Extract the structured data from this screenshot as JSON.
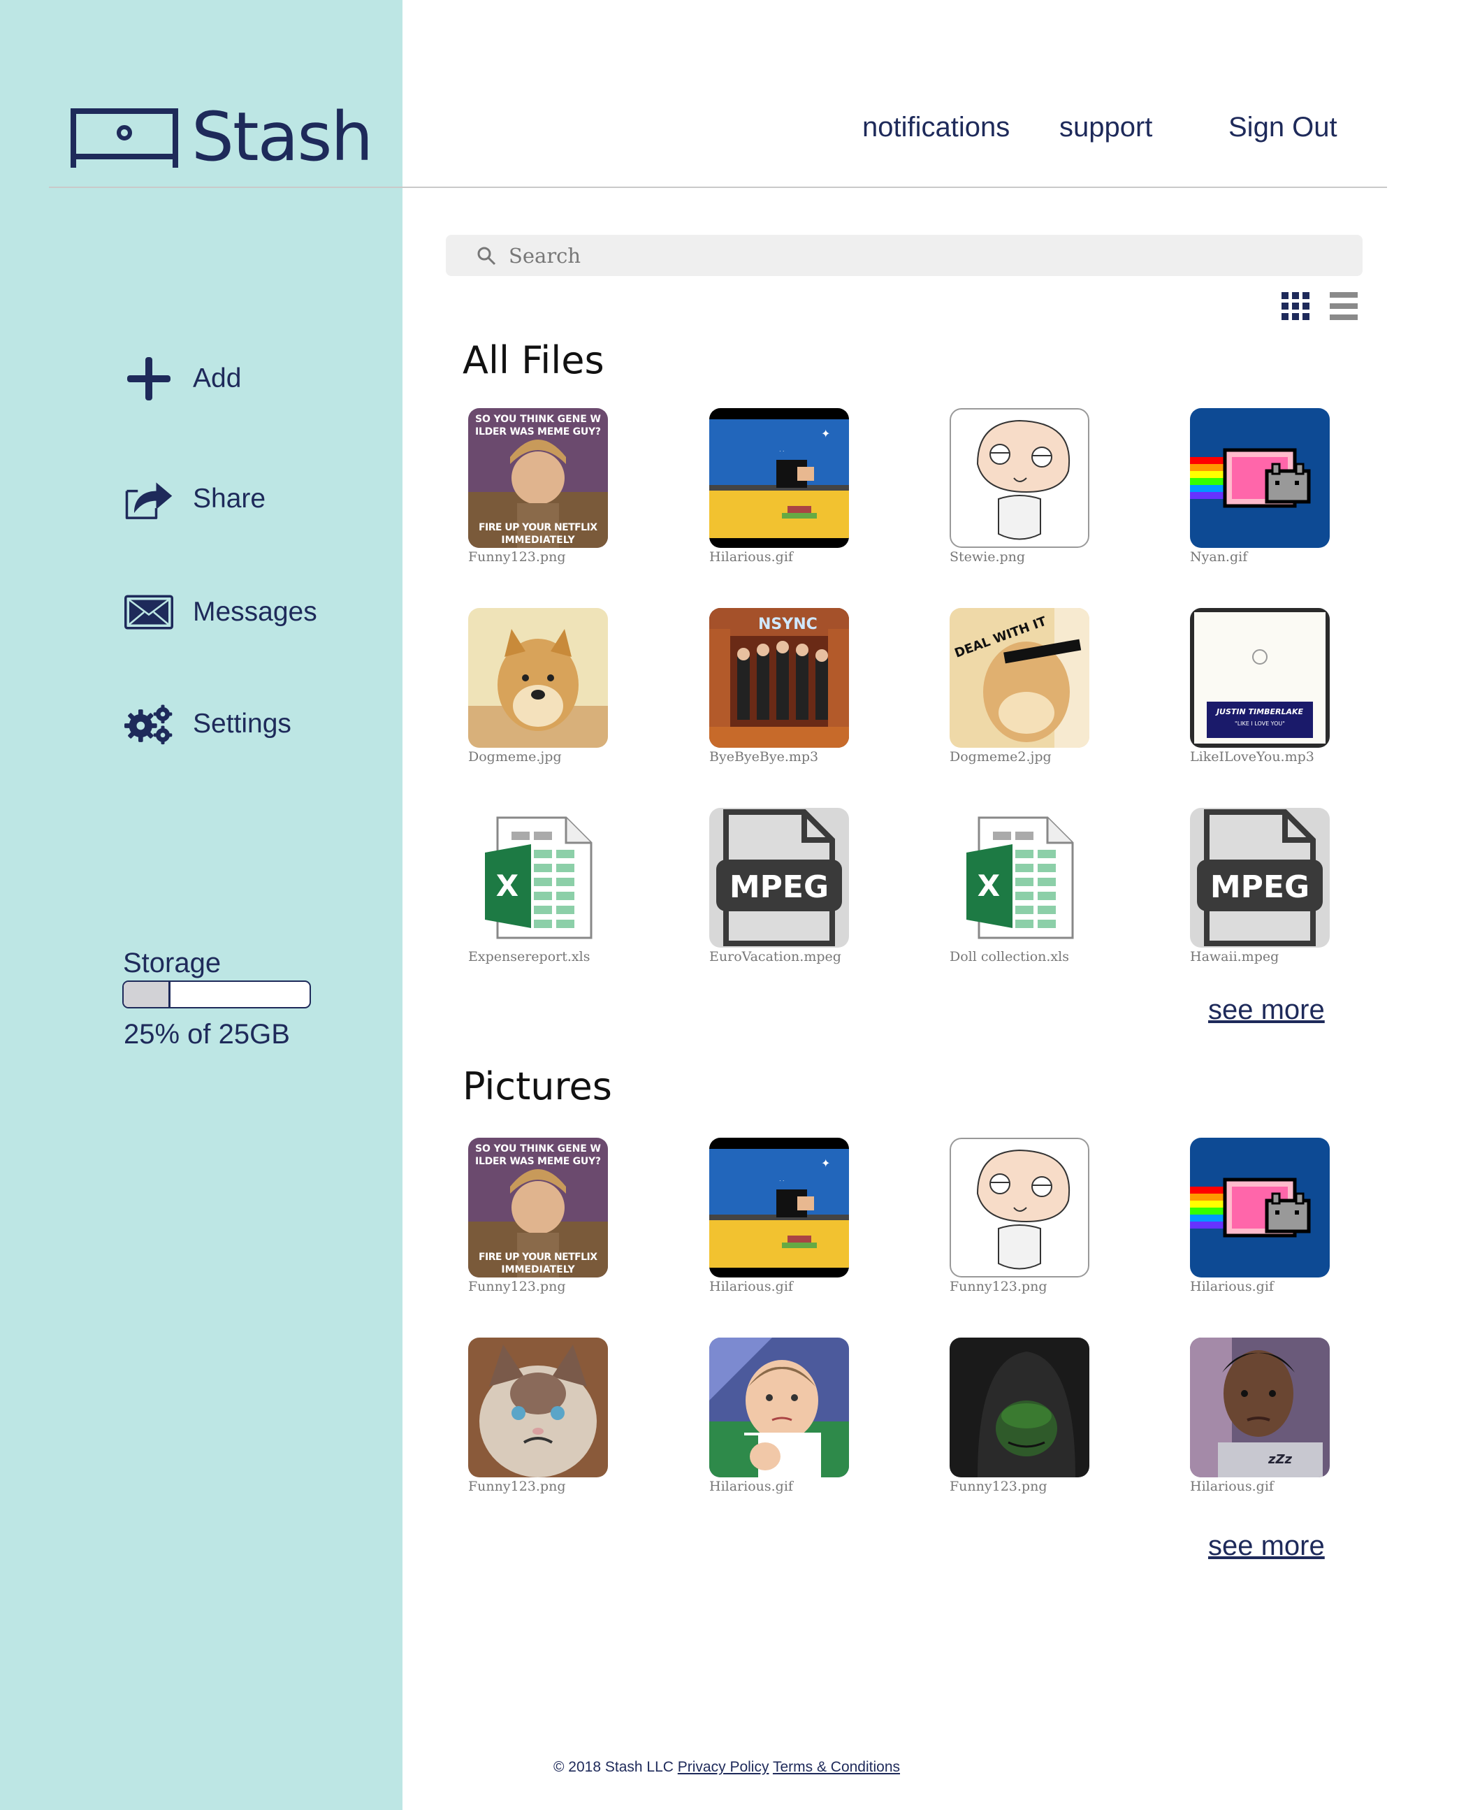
{
  "app": {
    "name": "Stash"
  },
  "topnav": {
    "notifications": "notifications",
    "support": "support",
    "signout": "Sign Out"
  },
  "sidebar": {
    "items": [
      {
        "label": "Add",
        "icon": "plus-icon"
      },
      {
        "label": "Share",
        "icon": "share-icon"
      },
      {
        "label": "Messages",
        "icon": "mail-icon"
      },
      {
        "label": "Settings",
        "icon": "gear-icon"
      }
    ],
    "storage": {
      "label": "Storage",
      "used_fraction": 0.25,
      "text": "25% of 25GB"
    }
  },
  "search": {
    "placeholder": "Search"
  },
  "view_toggle": {
    "active": "grid"
  },
  "sections": [
    {
      "title": "All Files",
      "see_more": "see more",
      "files": [
        {
          "name": "Funny123.png",
          "kind": "meme-wonka"
        },
        {
          "name": "Hilarious.gif",
          "kind": "pixel-game"
        },
        {
          "name": "Stewie.png",
          "kind": "cartoon"
        },
        {
          "name": "Nyan.gif",
          "kind": "nyan"
        },
        {
          "name": "Dogmeme.jpg",
          "kind": "doge"
        },
        {
          "name": "ByeByeBye.mp3",
          "kind": "band"
        },
        {
          "name": "Dogmeme2.jpg",
          "kind": "doge2"
        },
        {
          "name": "LikeILoveYou.mp3",
          "kind": "record"
        },
        {
          "name": "Expensereport.xls",
          "kind": "xls"
        },
        {
          "name": "EuroVacation.mpeg",
          "kind": "mpeg"
        },
        {
          "name": "Doll collection.xls",
          "kind": "xls"
        },
        {
          "name": "Hawaii.mpeg",
          "kind": "mpeg"
        }
      ]
    },
    {
      "title": "Pictures",
      "see_more": "see more",
      "files": [
        {
          "name": "Funny123.png",
          "kind": "meme-wonka"
        },
        {
          "name": "Hilarious.gif",
          "kind": "pixel-game"
        },
        {
          "name": "Funny123.png",
          "kind": "cartoon"
        },
        {
          "name": "Hilarious.gif",
          "kind": "nyan"
        },
        {
          "name": "Funny123.png",
          "kind": "grumpy"
        },
        {
          "name": "Hilarious.gif",
          "kind": "baby"
        },
        {
          "name": "Funny123.png",
          "kind": "kermit"
        },
        {
          "name": "Hilarious.gif",
          "kind": "guy"
        }
      ]
    }
  ],
  "thumb_text": {
    "wonka_top": "SO YOU THINK GENE WILDER WAS MEME GUY?",
    "wonka_bottom": "FIRE UP YOUR NETFLIX IMMEDIATELY",
    "nsync": "NSYNC",
    "record": "JUSTIN TIMBERLAKE",
    "record_sub": "\"LIKE I LOVE YOU\"",
    "xls_letter": "X",
    "mpeg": "MPEG",
    "doge2": "DEAL WITH IT"
  },
  "footer": {
    "copyright": "© 2018 Stash LLC",
    "privacy": "Privacy Policy",
    "terms": "Terms & Conditions"
  },
  "colors": {
    "sidebar": "#bde6e4",
    "navy": "#1e2a5a",
    "search_bg": "#efefef"
  }
}
